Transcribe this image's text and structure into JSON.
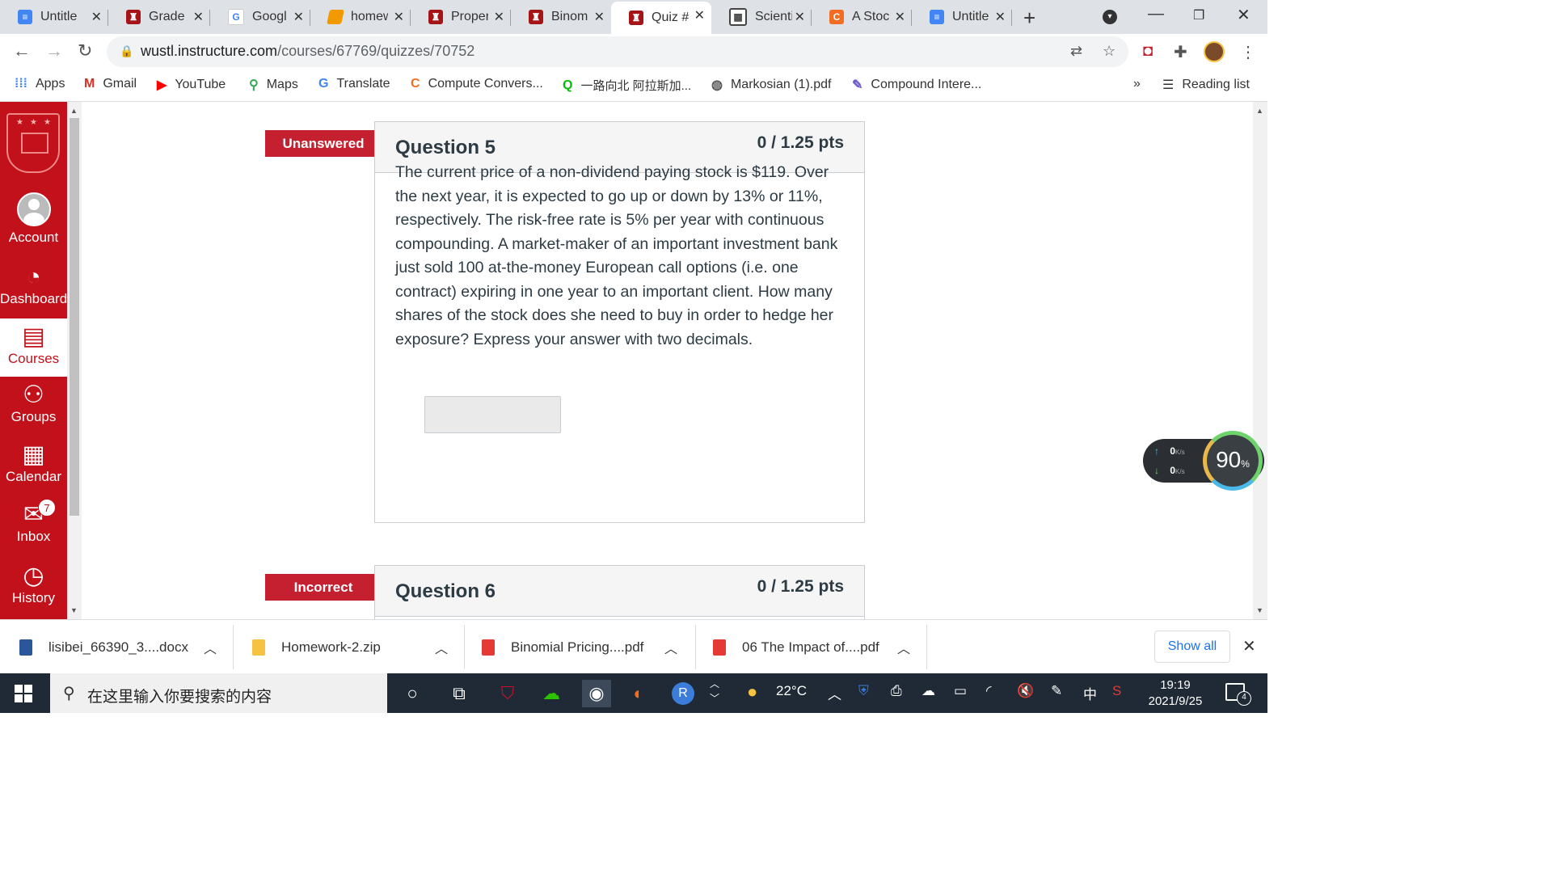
{
  "browser": {
    "tabs": [
      {
        "title": "Untitle",
        "icon": "google-docs-icon"
      },
      {
        "title": "Grade",
        "icon": "wustl-crest-icon"
      },
      {
        "title": "Googl",
        "icon": "google-icon"
      },
      {
        "title": "homew",
        "icon": "book-icon"
      },
      {
        "title": "Proper",
        "icon": "wustl-crest-icon"
      },
      {
        "title": "Binom",
        "icon": "wustl-crest-icon"
      },
      {
        "title": "Quiz #",
        "icon": "wustl-crest-icon",
        "active": true
      },
      {
        "title": "Scienti",
        "icon": "calculator-icon"
      },
      {
        "title": "A Stoc",
        "icon": "chegg-icon"
      },
      {
        "title": "Untitle",
        "icon": "google-docs-icon"
      }
    ],
    "url_host": "wustl.instructure.com",
    "url_path": "/courses/67769/quizzes/70752",
    "bookmarks": [
      {
        "label": "Apps",
        "icon": "apps-grid-icon"
      },
      {
        "label": "Gmail",
        "icon": "gmail-icon"
      },
      {
        "label": "YouTube",
        "icon": "youtube-icon"
      },
      {
        "label": "Maps",
        "icon": "maps-pin-icon"
      },
      {
        "label": "Translate",
        "icon": "translate-icon"
      },
      {
        "label": "Compute Convers...",
        "icon": "chegg-icon"
      },
      {
        "label": "一路向北 阿拉斯加...",
        "icon": "iqiyi-icon"
      },
      {
        "label": "Markosian (1).pdf",
        "icon": "globe-icon"
      },
      {
        "label": "Compound Intere...",
        "icon": "site-icon"
      }
    ],
    "bookmarks_overflow": "»",
    "reading_list": "Reading list"
  },
  "sidebar": {
    "items": [
      {
        "label": "Account",
        "icon": "account-avatar-icon"
      },
      {
        "label": "Dashboard",
        "icon": "dashboard-gauge-icon"
      },
      {
        "label": "Courses",
        "icon": "courses-book-icon",
        "active": true
      },
      {
        "label": "Groups",
        "icon": "groups-people-icon"
      },
      {
        "label": "Calendar",
        "icon": "calendar-icon"
      },
      {
        "label": "Inbox",
        "icon": "inbox-icon",
        "badge": "7"
      },
      {
        "label": "History",
        "icon": "history-clock-icon"
      }
    ]
  },
  "questions": [
    {
      "status": "Unanswered",
      "title": "Question 5",
      "points": "0 / 1.25 pts",
      "text": "The current price of a non-dividend paying stock is $119. Over the next year, it is expected to go up or down by 13% or 11%, respectively. The risk-free rate is 5% per year with continuous compounding. A market-maker of an important investment bank just sold 100 at-the-money European call options (i.e. one contract) expiring in one year to an important client. How many shares of the stock does she need to buy in order to hedge her exposure? Express your answer with two decimals.",
      "answer_value": ""
    },
    {
      "status": "Incorrect",
      "title": "Question 6",
      "points": "0 / 1.25 pts"
    }
  ],
  "speed_widget": {
    "upload": "0",
    "download": "0",
    "unit": "K/s",
    "percent": "90",
    "percent_sign": "%"
  },
  "downloads": {
    "items": [
      {
        "name": "lisibei_66390_3....docx",
        "icon": "word-doc-icon"
      },
      {
        "name": "Homework-2.zip",
        "icon": "zip-archive-icon"
      },
      {
        "name": "Binomial Pricing....pdf",
        "icon": "pdf-icon"
      },
      {
        "name": "06 The Impact of....pdf",
        "icon": "pdf-icon"
      }
    ],
    "show_all": "Show all"
  },
  "taskbar": {
    "search_placeholder": "在这里输入你要搜索的内容",
    "weather": "22°C",
    "ime": "中",
    "time": "19:19",
    "date": "2021/9/25",
    "notifications": "4"
  },
  "colors": {
    "canvas_red": "#c2111a",
    "flag_red": "#c5202f",
    "link_blue": "#1a73e8"
  }
}
